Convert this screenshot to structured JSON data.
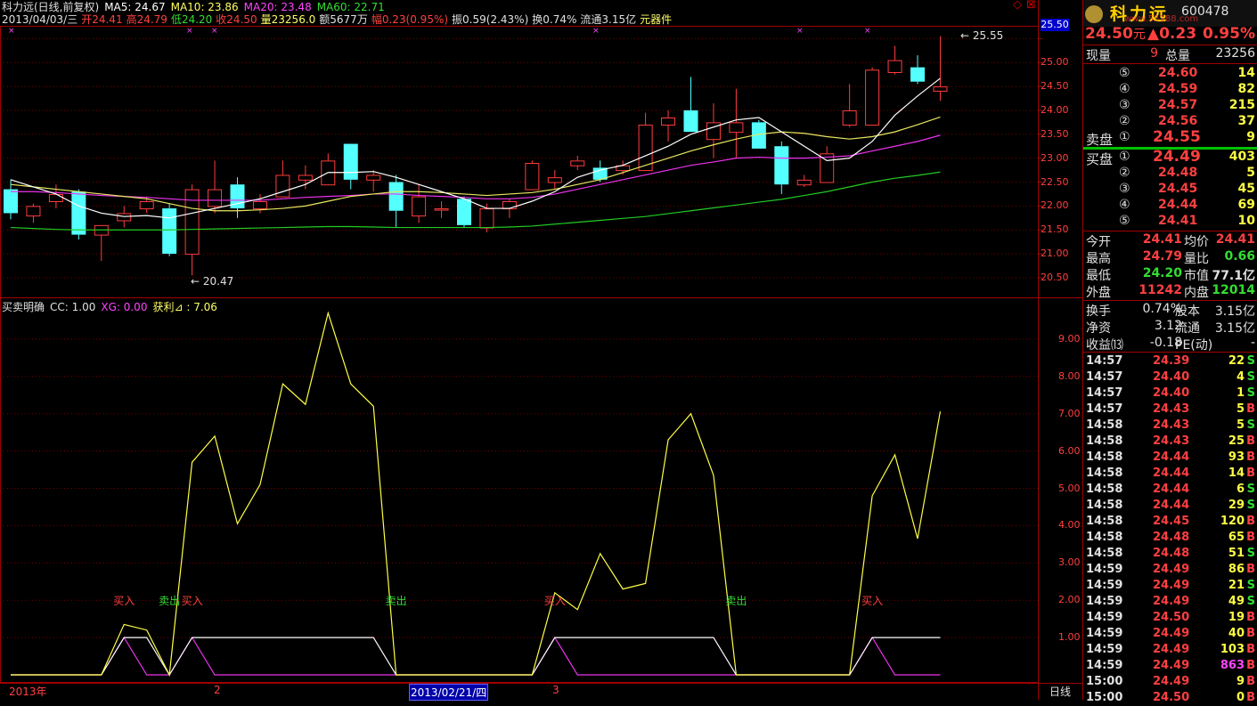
{
  "title_bar": {
    "line1": [
      {
        "text": "科力远(日线,前复权)",
        "color": "#e0e0e0"
      },
      {
        "text": "MA5: 24.67",
        "color": "#ffffff"
      },
      {
        "text": "MA10: 23.86",
        "color": "#ffff66"
      },
      {
        "text": "MA20: 23.48",
        "color": "#ff44ff"
      },
      {
        "text": "MA60: 22.71",
        "color": "#33dd33"
      }
    ],
    "line2": [
      {
        "text": "2013/04/03/三",
        "color": "#e0e0e0"
      },
      {
        "text": "开24.41",
        "color": "#ff4040"
      },
      {
        "text": "高24.79",
        "color": "#ff4040"
      },
      {
        "text": "低24.20",
        "color": "#33dd33"
      },
      {
        "text": "收24.50",
        "color": "#ff4040"
      },
      {
        "text": "量23256.0",
        "color": "#ffff66"
      },
      {
        "text": "额5677万",
        "color": "#e0e0e0"
      },
      {
        "text": "幅0.23(0.95%)",
        "color": "#ff4040"
      },
      {
        "text": "振0.59(2.43%)",
        "color": "#e0e0e0"
      },
      {
        "text": "换0.74%",
        "color": "#e0e0e0"
      },
      {
        "text": "流通3.15亿",
        "color": "#e0e0e0"
      },
      {
        "text": "元器件",
        "color": "#ffff66"
      }
    ]
  },
  "indicator_title": [
    {
      "text": "买卖明确",
      "color": "#e0e0e0"
    },
    {
      "text": "CC: 1.00",
      "color": "#e0e0e0"
    },
    {
      "text": "XG: 0.00",
      "color": "#ff44ff"
    },
    {
      "text": "获利⊿ : 7.06",
      "color": "#ffff66"
    }
  ],
  "logo": {
    "name": "科力远",
    "url": "www.55188.com",
    "code": "600478"
  },
  "axis_highlight": "25.50",
  "high_label": "25.55",
  "low_label": "20.47",
  "price_axis": [
    "25.50",
    "25.00",
    "24.50",
    "24.00",
    "23.50",
    "23.00",
    "22.50",
    "22.00",
    "21.50",
    "21.00",
    "20.50"
  ],
  "ind_axis": [
    "9.00",
    "8.00",
    "7.00",
    "6.00",
    "5.00",
    "4.00",
    "3.00",
    "2.00",
    "1.00"
  ],
  "bottom_axis": {
    "year": "2013年",
    "month2": "2",
    "cursor_date": "2013/02/21/四",
    "month3": "3",
    "period": "日线"
  },
  "signals": [
    {
      "text": "买入",
      "color": "#ff4040"
    },
    {
      "text": "卖出",
      "color": "#33dd33"
    },
    {
      "text": "买入",
      "color": "#ff4040"
    },
    {
      "text": "卖出",
      "color": "#33dd33"
    },
    {
      "text": "买入",
      "color": "#ff4040"
    },
    {
      "text": "卖出",
      "color": "#33dd33"
    },
    {
      "text": "买入",
      "color": "#ff4040"
    }
  ],
  "quote": {
    "price": "24.50",
    "unit": "元",
    "change": "▲0.23",
    "pct": "0.95%",
    "xianliang_label": "现量",
    "xianliang": "9",
    "zongliang_label": "总量",
    "zongliang": "23256",
    "ask_label": "卖盘",
    "bid_label": "买盘",
    "asks": [
      {
        "lvl": "⑤",
        "price": "24.60",
        "vol": "14"
      },
      {
        "lvl": "④",
        "price": "24.59",
        "vol": "82"
      },
      {
        "lvl": "③",
        "price": "24.57",
        "vol": "215"
      },
      {
        "lvl": "②",
        "price": "24.56",
        "vol": "37"
      },
      {
        "lvl": "①",
        "price": "24.55",
        "vol": "9"
      }
    ],
    "bids": [
      {
        "lvl": "①",
        "price": "24.49",
        "vol": "403"
      },
      {
        "lvl": "②",
        "price": "24.48",
        "vol": "5"
      },
      {
        "lvl": "③",
        "price": "24.45",
        "vol": "45"
      },
      {
        "lvl": "④",
        "price": "24.44",
        "vol": "69"
      },
      {
        "lvl": "⑤",
        "price": "24.41",
        "vol": "10"
      }
    ],
    "stats": [
      {
        "l1": "今开",
        "v1": "24.41",
        "c1": "#ff4040",
        "l2": "均价",
        "v2": "24.41",
        "c2": "#ff4040"
      },
      {
        "l1": "最高",
        "v1": "24.79",
        "c1": "#ff4040",
        "l2": "量比",
        "v2": "0.66",
        "c2": "#33dd33"
      },
      {
        "l1": "最低",
        "v1": "24.20",
        "c1": "#33dd33",
        "l2": "市值",
        "v2": "77.1亿",
        "c2": "#e0e0e0"
      },
      {
        "l1": "外盘",
        "v1": "11242",
        "c1": "#ff4040",
        "l2": "内盘",
        "v2": "12014",
        "c2": "#33dd33"
      }
    ],
    "info": [
      {
        "l1": "换手",
        "v1": "0.74%",
        "l2": "股本",
        "v2": "3.15亿"
      },
      {
        "l1": "净资",
        "v1": "3.12",
        "l2": "流通",
        "v2": "3.15亿"
      },
      {
        "l1": "收益⒀",
        "v1": "-0.18",
        "l2": "PE(动)",
        "v2": "-"
      }
    ]
  },
  "ticks": [
    {
      "t": "14:57",
      "p": "24.39",
      "v": "22",
      "s": "S"
    },
    {
      "t": "14:57",
      "p": "24.40",
      "v": "4",
      "s": "S"
    },
    {
      "t": "14:57",
      "p": "24.40",
      "v": "1",
      "s": "S"
    },
    {
      "t": "14:57",
      "p": "24.43",
      "v": "5",
      "s": "B"
    },
    {
      "t": "14:58",
      "p": "24.43",
      "v": "5",
      "s": "S"
    },
    {
      "t": "14:58",
      "p": "24.43",
      "v": "25",
      "s": "B"
    },
    {
      "t": "14:58",
      "p": "24.44",
      "v": "93",
      "s": "B"
    },
    {
      "t": "14:58",
      "p": "24.44",
      "v": "14",
      "s": "B"
    },
    {
      "t": "14:58",
      "p": "24.44",
      "v": "6",
      "s": "S"
    },
    {
      "t": "14:58",
      "p": "24.44",
      "v": "29",
      "s": "S"
    },
    {
      "t": "14:58",
      "p": "24.45",
      "v": "120",
      "s": "B"
    },
    {
      "t": "14:58",
      "p": "24.48",
      "v": "65",
      "s": "B"
    },
    {
      "t": "14:58",
      "p": "24.48",
      "v": "51",
      "s": "S"
    },
    {
      "t": "14:59",
      "p": "24.49",
      "v": "86",
      "s": "B"
    },
    {
      "t": "14:59",
      "p": "24.49",
      "v": "21",
      "s": "S"
    },
    {
      "t": "14:59",
      "p": "24.49",
      "v": "49",
      "s": "S"
    },
    {
      "t": "14:59",
      "p": "24.50",
      "v": "19",
      "s": "B"
    },
    {
      "t": "14:59",
      "p": "24.49",
      "v": "40",
      "s": "B"
    },
    {
      "t": "14:59",
      "p": "24.49",
      "v": "103",
      "s": "B"
    },
    {
      "t": "14:59",
      "p": "24.49",
      "v": "863",
      "s": "B"
    },
    {
      "t": "15:00",
      "p": "24.49",
      "v": "9",
      "s": "B"
    },
    {
      "t": "15:00",
      "p": "24.50",
      "v": "0",
      "s": "B"
    }
  ],
  "chart_data": {
    "type": "line",
    "candles": [
      [
        22.35,
        22.55,
        21.72,
        21.85
      ],
      [
        21.8,
        22.05,
        21.65,
        22.0
      ],
      [
        22.1,
        22.45,
        21.95,
        22.25
      ],
      [
        22.3,
        22.35,
        21.3,
        21.4
      ],
      [
        21.4,
        21.6,
        20.85,
        21.6
      ],
      [
        21.7,
        22.0,
        21.55,
        21.85
      ],
      [
        21.95,
        22.2,
        21.85,
        22.1
      ],
      [
        21.95,
        22.05,
        20.95,
        21.0
      ],
      [
        21.0,
        22.45,
        20.55,
        22.35
      ],
      [
        22.0,
        22.95,
        21.85,
        22.35
      ],
      [
        22.45,
        22.6,
        21.75,
        21.95
      ],
      [
        21.95,
        22.25,
        21.85,
        22.1
      ],
      [
        22.2,
        22.95,
        22.2,
        22.65
      ],
      [
        22.55,
        22.85,
        22.35,
        22.65
      ],
      [
        22.45,
        23.1,
        22.45,
        22.95
      ],
      [
        23.3,
        23.3,
        22.35,
        22.55
      ],
      [
        22.55,
        22.75,
        22.3,
        22.65
      ],
      [
        22.5,
        22.65,
        21.55,
        21.9
      ],
      [
        21.8,
        22.45,
        21.65,
        22.2
      ],
      [
        21.95,
        22.1,
        21.75,
        21.95
      ],
      [
        22.15,
        22.2,
        21.55,
        21.6
      ],
      [
        21.55,
        22.05,
        21.45,
        21.95
      ],
      [
        21.95,
        22.15,
        21.75,
        22.1
      ],
      [
        22.35,
        22.95,
        22.35,
        22.9
      ],
      [
        22.5,
        22.75,
        22.35,
        22.6
      ],
      [
        22.85,
        23.05,
        22.75,
        22.95
      ],
      [
        22.8,
        22.95,
        22.5,
        22.55
      ],
      [
        22.75,
        22.95,
        22.65,
        22.85
      ],
      [
        22.75,
        23.95,
        22.75,
        23.7
      ],
      [
        23.7,
        24.0,
        23.35,
        23.85
      ],
      [
        24.0,
        24.7,
        23.55,
        23.55
      ],
      [
        23.4,
        24.15,
        23.0,
        23.75
      ],
      [
        23.55,
        24.45,
        23.0,
        23.75
      ],
      [
        23.75,
        23.8,
        23.25,
        23.2
      ],
      [
        23.25,
        23.35,
        22.25,
        22.45
      ],
      [
        22.45,
        22.65,
        22.4,
        22.55
      ],
      [
        22.5,
        23.25,
        22.5,
        23.1
      ],
      [
        23.7,
        24.55,
        23.65,
        24.0
      ],
      [
        23.7,
        24.9,
        23.7,
        24.85
      ],
      [
        24.8,
        25.35,
        24.75,
        25.05
      ],
      [
        24.9,
        25.15,
        24.55,
        24.6
      ],
      [
        24.41,
        25.55,
        24.2,
        24.5
      ]
    ],
    "ma5": [
      22.55,
      22.4,
      22.25,
      22.0,
      21.85,
      21.78,
      21.8,
      21.75,
      21.85,
      21.95,
      22.05,
      22.15,
      22.3,
      22.45,
      22.7,
      22.7,
      22.72,
      22.6,
      22.45,
      22.3,
      22.15,
      21.95,
      21.95,
      22.1,
      22.3,
      22.6,
      22.75,
      22.85,
      23.05,
      23.25,
      23.5,
      23.65,
      23.8,
      23.85,
      23.55,
      23.25,
      22.95,
      23.0,
      23.35,
      23.9,
      24.3,
      24.67
    ],
    "ma10": [
      22.45,
      22.4,
      22.35,
      22.3,
      22.25,
      22.2,
      22.15,
      22.05,
      21.95,
      21.9,
      21.9,
      21.92,
      21.95,
      22.0,
      22.1,
      22.2,
      22.25,
      22.3,
      22.3,
      22.28,
      22.25,
      22.22,
      22.25,
      22.28,
      22.35,
      22.45,
      22.55,
      22.7,
      22.85,
      23.0,
      23.15,
      23.28,
      23.4,
      23.5,
      23.55,
      23.52,
      23.45,
      23.4,
      23.45,
      23.55,
      23.7,
      23.86
    ],
    "ma20": [
      22.3,
      22.3,
      22.28,
      22.25,
      22.22,
      22.2,
      22.18,
      22.15,
      22.12,
      22.12,
      22.12,
      22.12,
      22.15,
      22.18,
      22.2,
      22.22,
      22.25,
      22.25,
      22.22,
      22.2,
      22.18,
      22.15,
      22.15,
      22.18,
      22.25,
      22.35,
      22.45,
      22.55,
      22.65,
      22.75,
      22.85,
      22.92,
      23.0,
      23.02,
      23.0,
      23.0,
      23.02,
      23.05,
      23.15,
      23.25,
      23.35,
      23.48
    ],
    "ma60": [
      21.55,
      21.53,
      21.51,
      21.5,
      21.5,
      21.5,
      21.5,
      21.5,
      21.51,
      21.52,
      21.53,
      21.54,
      21.55,
      21.56,
      21.57,
      21.57,
      21.56,
      21.55,
      21.55,
      21.55,
      21.55,
      21.55,
      21.56,
      21.58,
      21.62,
      21.66,
      21.7,
      21.74,
      21.78,
      21.84,
      21.9,
      21.96,
      22.02,
      22.08,
      22.14,
      22.22,
      22.3,
      22.4,
      22.5,
      22.58,
      22.64,
      22.71
    ],
    "indicator_yellow": [
      0,
      0,
      0,
      0,
      0,
      1.35,
      1.2,
      0,
      5.7,
      6.4,
      4.05,
      5.1,
      7.8,
      7.25,
      9.7,
      7.8,
      7.2,
      0,
      0,
      0,
      0,
      0,
      0,
      0,
      2.2,
      1.75,
      3.25,
      2.3,
      2.45,
      6.3,
      7.0,
      5.35,
      0,
      0,
      0,
      0,
      0,
      0,
      4.8,
      5.9,
      3.65,
      7.06
    ],
    "indicator_white": [
      0,
      0,
      0,
      0,
      0,
      1,
      1,
      0,
      1,
      1,
      1,
      1,
      1,
      1,
      1,
      1,
      1,
      0,
      0,
      0,
      0,
      0,
      0,
      0,
      1,
      1,
      1,
      1,
      1,
      1,
      1,
      1,
      0,
      0,
      0,
      0,
      0,
      0,
      1,
      1,
      1,
      1
    ],
    "indicator_magenta": [
      0,
      0,
      0,
      0,
      0,
      1,
      0,
      0,
      1,
      0,
      0,
      0,
      0,
      0,
      0,
      0,
      0,
      0,
      0,
      0,
      0,
      0,
      0,
      0,
      1,
      0,
      0,
      0,
      0,
      0,
      0,
      0,
      0,
      0,
      0,
      0,
      0,
      0,
      1,
      0,
      0,
      0
    ],
    "signal_bars": [
      5,
      7,
      8,
      17,
      24,
      32,
      38
    ],
    "price_ylim": [
      20.35,
      25.6
    ],
    "indicator_ylim": [
      0,
      10
    ]
  }
}
